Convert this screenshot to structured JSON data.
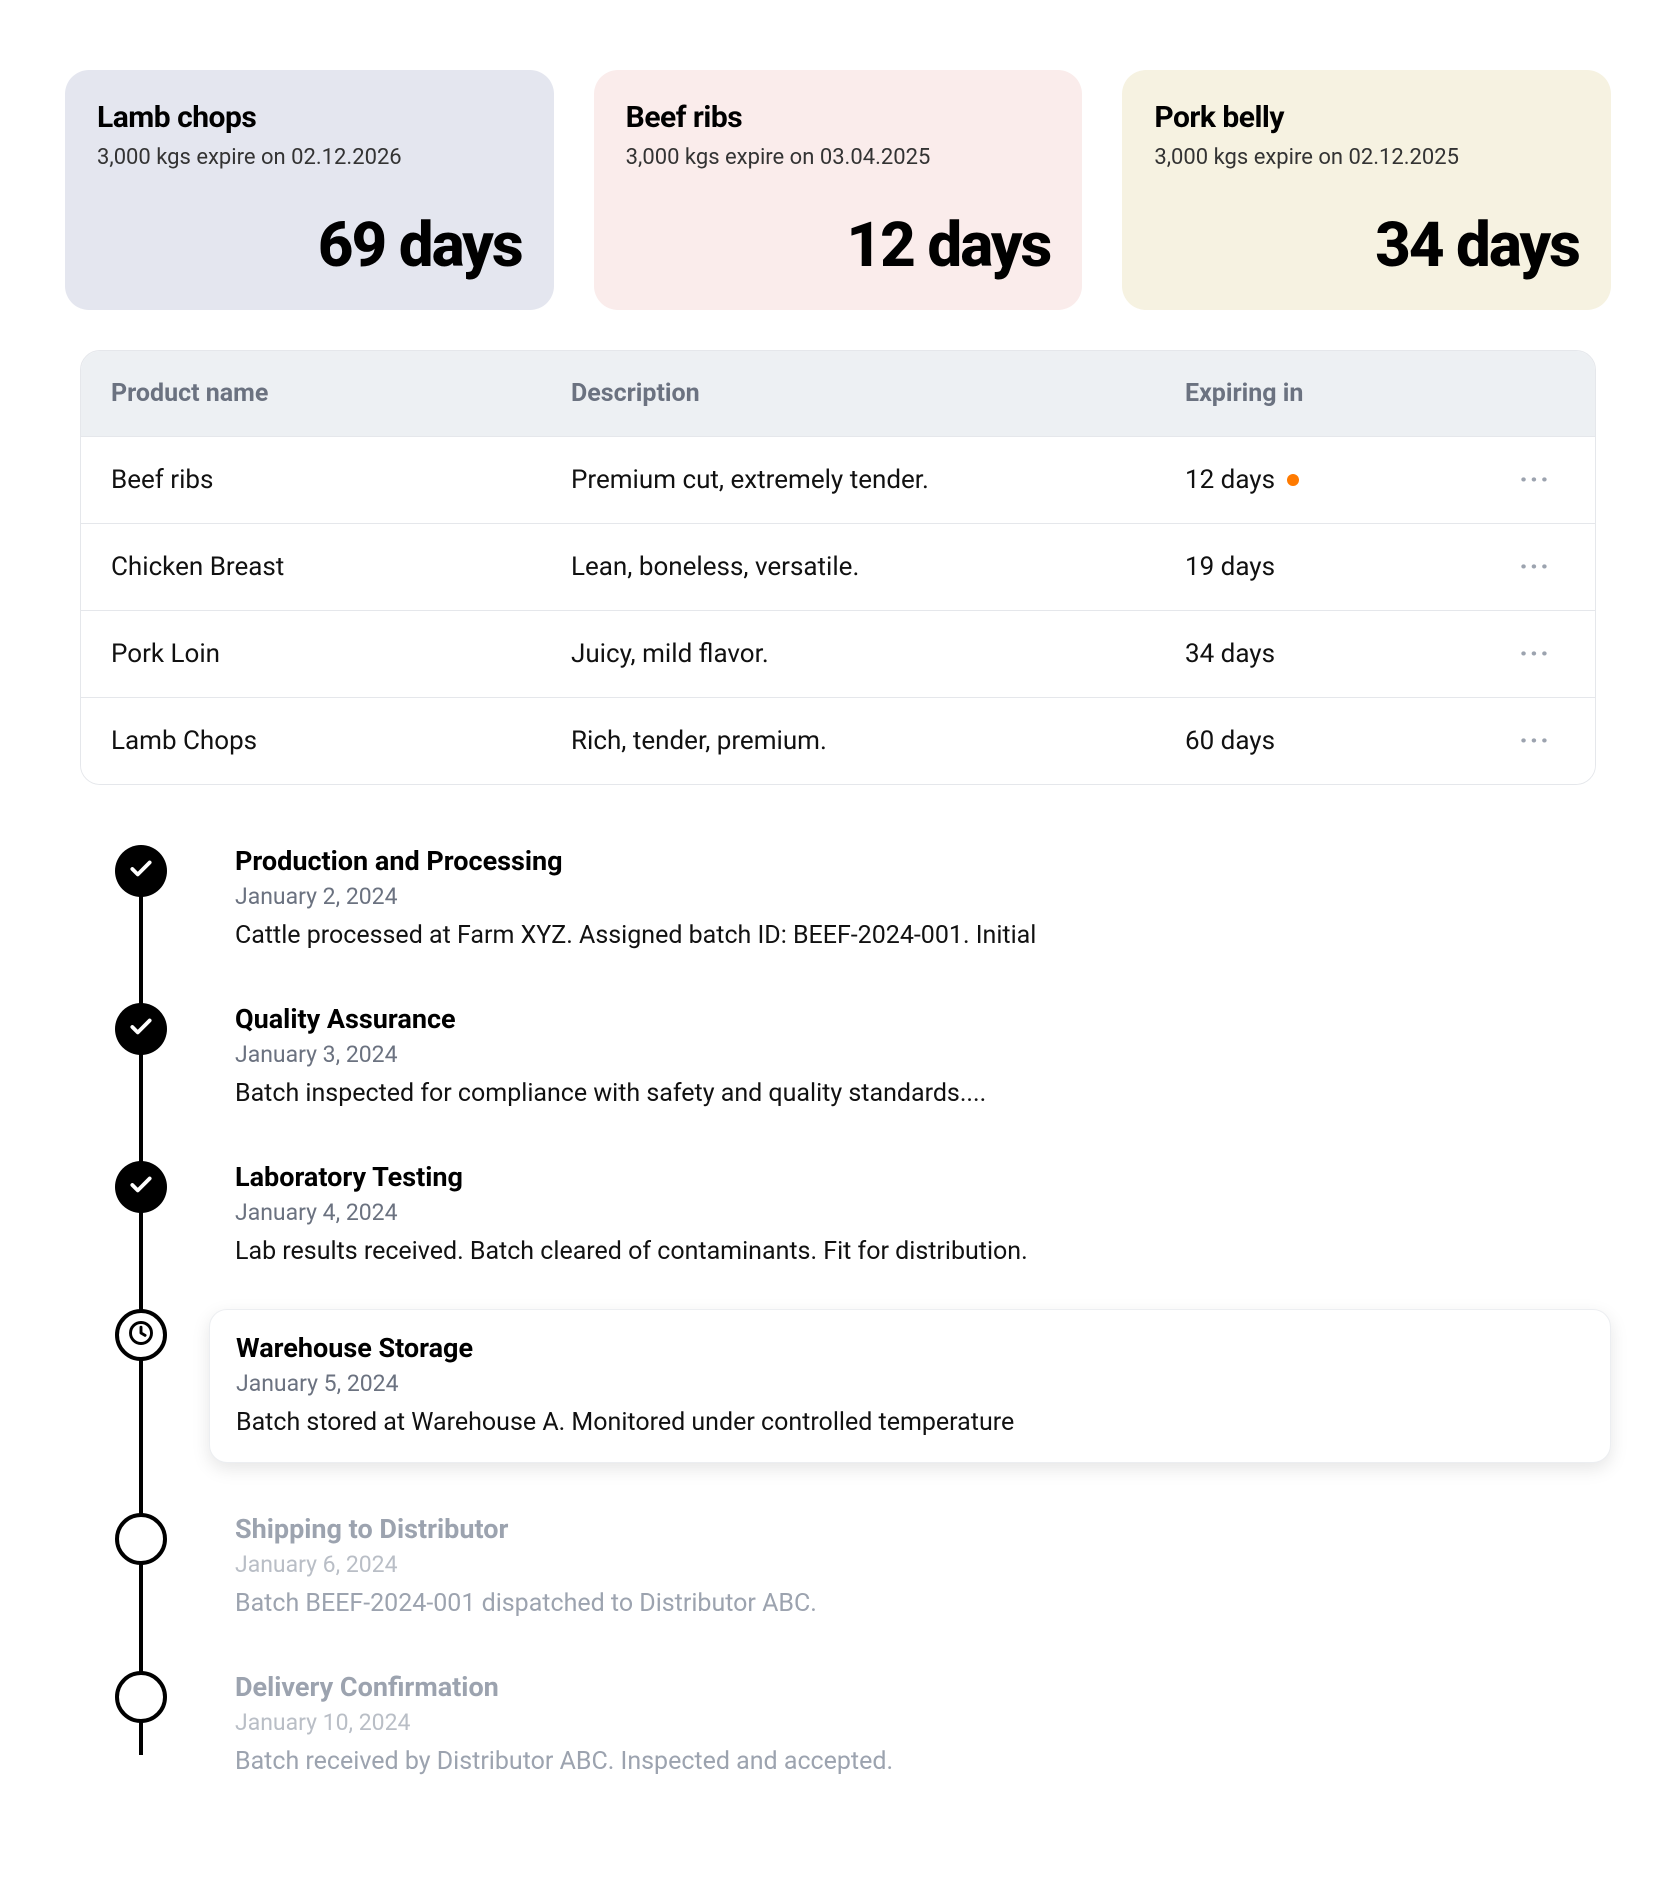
{
  "cards": [
    {
      "title": "Lamb chops",
      "sub": "3,000 kgs expire on 02.12.2026",
      "days": "69 days",
      "variant": "blue"
    },
    {
      "title": "Beef ribs",
      "sub": "3,000 kgs expire on 03.04.2025",
      "days": "12 days",
      "variant": "pink"
    },
    {
      "title": "Pork belly",
      "sub": "3,000 kgs expire on 02.12.2025",
      "days": "34 days",
      "variant": "cream"
    }
  ],
  "table": {
    "headers": {
      "name": "Product name",
      "desc": "Description",
      "exp": "Expiring in"
    },
    "rows": [
      {
        "name": "Beef ribs",
        "desc": "Premium cut, extremely tender.",
        "exp": "12 days",
        "warn": true
      },
      {
        "name": "Chicken Breast",
        "desc": "Lean, boneless, versatile.",
        "exp": "19 days",
        "warn": false
      },
      {
        "name": "Pork Loin",
        "desc": "Juicy, mild flavor.",
        "exp": "34 days",
        "warn": false
      },
      {
        "name": "Lamb Chops",
        "desc": "Rich, tender, premium.",
        "exp": "60 days",
        "warn": false
      }
    ]
  },
  "timeline": [
    {
      "status": "done",
      "title": "Production and Processing",
      "date": "January 2, 2024",
      "desc": "Cattle processed at Farm XYZ. Assigned batch ID: BEEF-2024-001. Initial"
    },
    {
      "status": "done",
      "title": "Quality Assurance",
      "date": "January 3, 2024",
      "desc": "Batch inspected for compliance with safety and quality standards...."
    },
    {
      "status": "done",
      "title": "Laboratory Testing",
      "date": "January 4, 2024",
      "desc": "Lab results received. Batch cleared of contaminants. Fit for distribution."
    },
    {
      "status": "current",
      "title": "Warehouse Storage",
      "date": "January 5, 2024",
      "desc": "Batch stored at Warehouse A. Monitored under controlled temperature"
    },
    {
      "status": "future",
      "title": "Shipping to Distributor",
      "date": "January 6, 2024",
      "desc": "Batch BEEF-2024-001 dispatched to Distributor ABC."
    },
    {
      "status": "future",
      "title": "Delivery Confirmation",
      "date": "January 10, 2024",
      "desc": "Batch received by Distributor ABC. Inspected and accepted."
    }
  ]
}
